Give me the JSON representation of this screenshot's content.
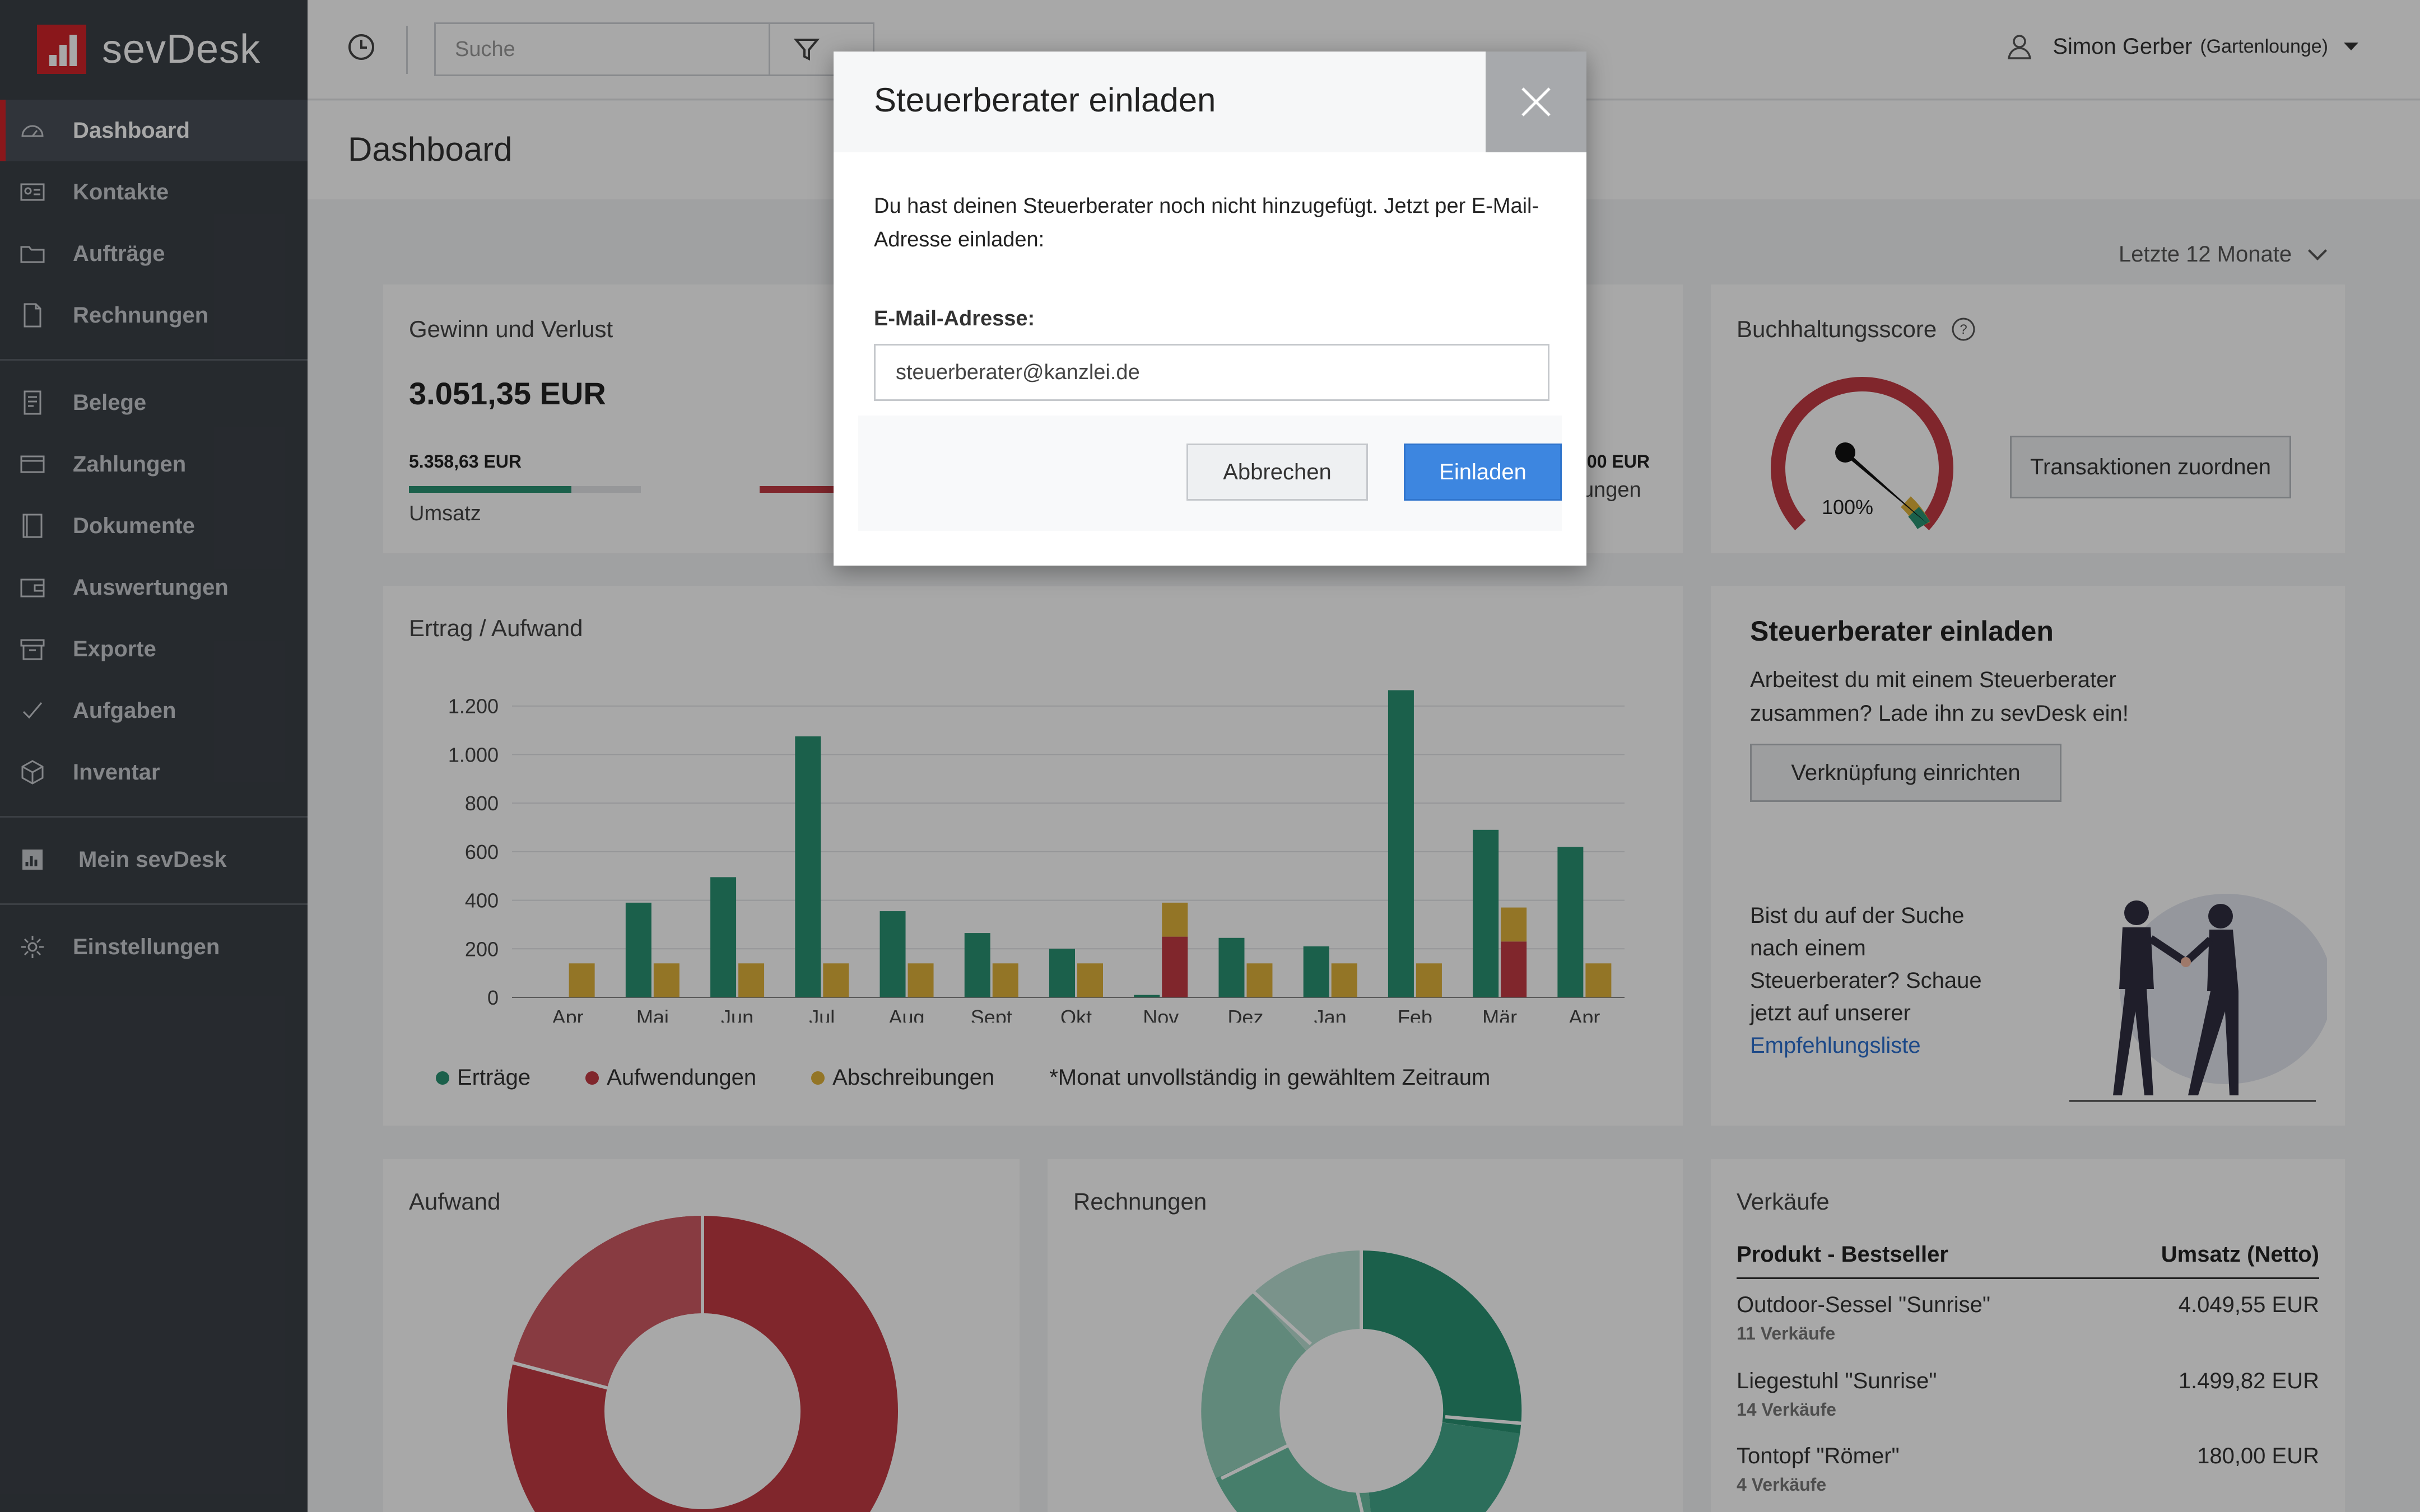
{
  "app": {
    "logo_text": "sevDesk",
    "brand_color": "#d2232a"
  },
  "sidebar": {
    "items": [
      {
        "label": "Dashboard",
        "icon": "speedometer-icon",
        "active": true
      },
      {
        "label": "Kontakte",
        "icon": "contact-card-icon"
      },
      {
        "label": "Aufträge",
        "icon": "folder-icon"
      },
      {
        "label": "Rechnungen",
        "icon": "document-icon"
      },
      {
        "label": "Belege",
        "icon": "receipt-icon"
      },
      {
        "label": "Zahlungen",
        "icon": "credit-card-icon"
      },
      {
        "label": "Dokumente",
        "icon": "binder-icon"
      },
      {
        "label": "Auswertungen",
        "icon": "wallet-icon"
      },
      {
        "label": "Exporte",
        "icon": "archive-box-icon"
      },
      {
        "label": "Aufgaben",
        "icon": "checkmark-icon"
      },
      {
        "label": "Inventar",
        "icon": "package-icon"
      },
      {
        "label": "Mein sevDesk",
        "icon": "bar-chart-icon"
      },
      {
        "label": "Einstellungen",
        "icon": "gear-icon"
      }
    ]
  },
  "topbar": {
    "search_placeholder": "Suche",
    "user_name": "Simon Gerber",
    "user_company": "(Gartenlounge)"
  },
  "page": {
    "title": "Dashboard",
    "period": "Letzte 12 Monate"
  },
  "gewinn": {
    "title": "Gewinn und Verlust",
    "amount": "3.051,35 EUR",
    "umsatz_value": "5.358,63 EUR",
    "umsatz_label": "Umsatz",
    "umsatz_fill": 0.7,
    "right_value": ",00 EUR",
    "right_label": "ungen"
  },
  "score": {
    "title": "Buchhaltungsscore",
    "value_label": "100%",
    "value": 1.0,
    "button": "Transaktionen zuordnen"
  },
  "ertrag": {
    "title": "Ertrag / Aufwand",
    "footnote": "*Monat unvollständig in gewähltem Zeitraum"
  },
  "chart_data": {
    "type": "bar",
    "title": "Ertrag / Aufwand",
    "categories": [
      "Apr",
      "Mai",
      "Jun",
      "Jul",
      "Aug",
      "Sept",
      "Okt",
      "Nov",
      "Dez",
      "Jan",
      "Feb",
      "Mär",
      "Apr"
    ],
    "series": [
      {
        "name": "Erträge",
        "color": "#2a9273",
        "values": [
          0,
          390,
          495,
          1075,
          355,
          265,
          200,
          10,
          245,
          210,
          1265,
          690,
          620
        ]
      },
      {
        "name": "Aufwendungen",
        "color": "#c23a44",
        "values": [
          0,
          0,
          0,
          0,
          0,
          0,
          0,
          250,
          0,
          0,
          0,
          230,
          0
        ]
      },
      {
        "name": "Abschreibungen",
        "color": "#e0b23a",
        "values": [
          140,
          140,
          140,
          140,
          140,
          140,
          140,
          140,
          140,
          140,
          140,
          140,
          140
        ]
      }
    ],
    "stacked_series": [
      "Aufwendungen",
      "Abschreibungen"
    ],
    "yticks": [
      "0",
      "200",
      "400",
      "600",
      "800",
      "1.000",
      "1.200"
    ],
    "ylim": [
      0,
      1280
    ],
    "grid": true,
    "legend": "bottom-left"
  },
  "steuerberater_card": {
    "title": "Steuerberater einladen",
    "text": "Arbeitest du mit einem Steuerberater zusammen? Lade ihn zu sevDesk ein!",
    "button": "Verknüpfung einrichten",
    "text2": "Bist du auf der Suche nach einem Steuerberater? Schaue jetzt auf unserer",
    "link": "Empfehlungsliste"
  },
  "aufwand": {
    "title": "Aufwand"
  },
  "rechnungen": {
    "title": "Rechnungen"
  },
  "verkaeufe": {
    "title": "Verkäufe",
    "col_product": "Produkt - Bestseller",
    "col_revenue": "Umsatz (Netto)",
    "rows": [
      {
        "product": "Outdoor-Sessel \"Sunrise\"",
        "revenue": "4.049,55 EUR",
        "sales": "11 Verkäufe"
      },
      {
        "product": "Liegestuhl \"Sunrise\"",
        "revenue": "1.499,82 EUR",
        "sales": "14 Verkäufe"
      },
      {
        "product": "Tontopf \"Römer\"",
        "revenue": "180,00 EUR",
        "sales": "4 Verkäufe"
      }
    ]
  },
  "modal": {
    "title": "Steuerberater einladen",
    "text": "Du hast deinen Steuerberater noch nicht hinzugefügt. Jetzt per E-Mail-Adresse einladen:",
    "email_label": "E-Mail-Adresse:",
    "email_value": "steuerberater@kanzlei.de",
    "cancel": "Abbrechen",
    "confirm": "Einladen"
  }
}
